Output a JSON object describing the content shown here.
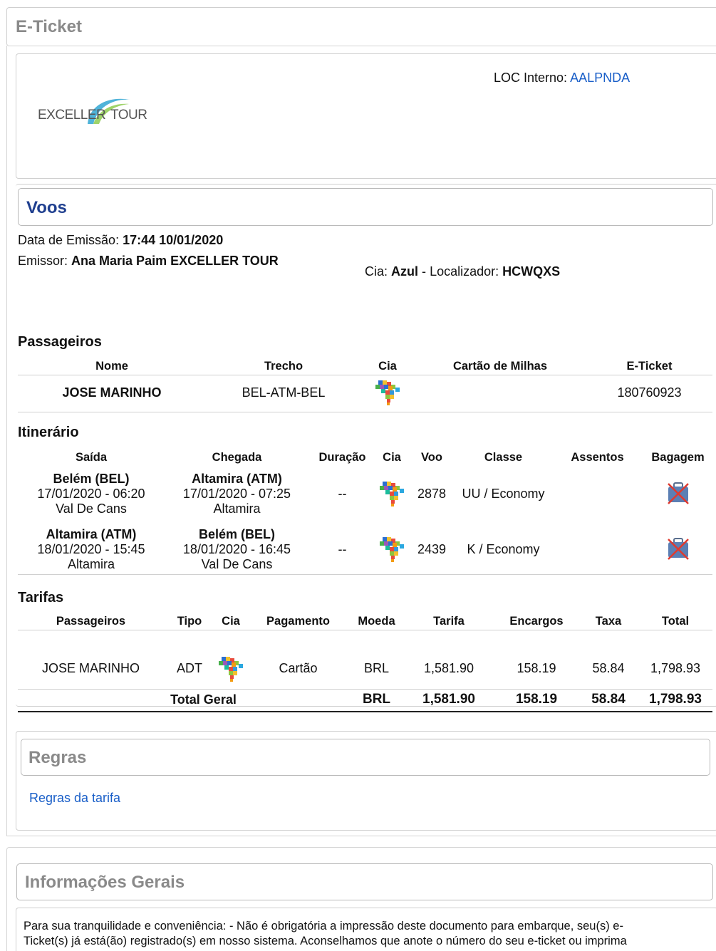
{
  "header": {
    "title": "E-Ticket"
  },
  "agency": {
    "logo_text_left": "EXCELLER",
    "logo_text_right": "TOUR",
    "loc_label": "LOC Interno:",
    "loc_value": "AALPNDA"
  },
  "voos": {
    "title": "Voos",
    "issue_label": "Data de Emissão:",
    "issue_value": "17:44 10/01/2020",
    "issuer_label": "Emissor:",
    "issuer_value": "Ana Maria Paim EXCELLER TOUR",
    "cia_label": "Cia:",
    "cia_value": "Azul",
    "sep": "-",
    "loc_label": "Localizador:",
    "loc_value": "HCWQXS"
  },
  "passengers": {
    "title": "Passageiros",
    "headers": [
      "Nome",
      "Trecho",
      "Cia",
      "Cartão de Milhas",
      "E-Ticket"
    ],
    "rows": [
      {
        "name": "JOSE MARINHO",
        "route": "BEL-ATM-BEL",
        "card": "",
        "eticket": "180760923"
      }
    ]
  },
  "itinerary": {
    "title": "Itinerário",
    "headers": [
      "Saída",
      "Chegada",
      "Duração",
      "Cia",
      "Voo",
      "Classe",
      "Assentos",
      "Bagagem"
    ],
    "rows": [
      {
        "dep_city": "Belém (BEL)",
        "dep_time": "17/01/2020 - 06:20",
        "dep_airport": "Val De Cans",
        "arr_city": "Altamira (ATM)",
        "arr_time": "17/01/2020 - 07:25",
        "arr_airport": "Altamira",
        "duration": "--",
        "flight": "2878",
        "class": "UU / Economy",
        "seats": ""
      },
      {
        "dep_city": "Altamira (ATM)",
        "dep_time": "18/01/2020 - 15:45",
        "dep_airport": "Altamira",
        "arr_city": "Belém (BEL)",
        "arr_time": "18/01/2020 - 16:45",
        "arr_airport": "Val De Cans",
        "duration": "--",
        "flight": "2439",
        "class": "K / Economy",
        "seats": ""
      }
    ]
  },
  "fares": {
    "title": "Tarifas",
    "headers": [
      "Passageiros",
      "Tipo",
      "Cia",
      "Pagamento",
      "Moeda",
      "Tarifa",
      "Encargos",
      "Taxa",
      "Total"
    ],
    "rows": [
      {
        "passenger": "JOSE MARINHO",
        "type": "ADT",
        "payment": "Cartão",
        "currency": "BRL",
        "fare": "1,581.90",
        "charges": "158.19",
        "tax": "58.84",
        "total": "1,798.93"
      }
    ],
    "total": {
      "label": "Total Geral",
      "currency": "BRL",
      "fare": "1,581.90",
      "charges": "158.19",
      "tax": "58.84",
      "total": "1,798.93"
    }
  },
  "rules": {
    "title": "Regras",
    "link": "Regras da tarifa"
  },
  "info": {
    "title": "Informações Gerais",
    "line1": "Para sua tranquilidade e conveniência: - Não é obrigatória a impressão deste documento para embarque, seu(s) e-",
    "line2": "Ticket(s) já está(ão) registrado(s) em nosso sistema. Aconselhamos que anote o número do seu e-ticket ou imprima"
  },
  "colors": {
    "link": "#1a5fc8",
    "voos_title": "#1f3f8f",
    "muted_title": "#8a8a8a"
  }
}
